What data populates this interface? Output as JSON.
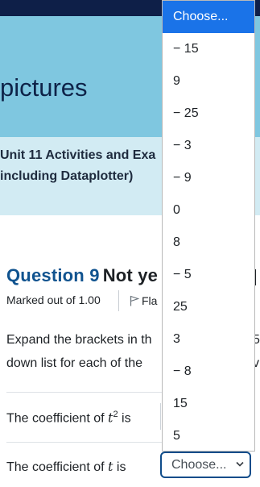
{
  "header": {
    "title_partial": "pictures",
    "subtitle_line1": "Unit 11 Activities and Exa",
    "subtitle_line2": "including Dataplotter)"
  },
  "question": {
    "number_label": "Question 9",
    "status_partial": "Not ye",
    "marked_out_of": "Marked out of 1.00",
    "flag_partial": "Fla",
    "instruction_line1": "Expand the brackets in th",
    "instruction_line2": "down list for each of the",
    "instruction_right1": "5",
    "instruction_right2": "v"
  },
  "rows": [
    {
      "label_prefix": "The coefficient of ",
      "var": "t",
      "sup": "2",
      "label_suffix": " is"
    },
    {
      "label_prefix": "The coefficient of ",
      "var": "t",
      "sup": "",
      "label_suffix": " is"
    }
  ],
  "select": {
    "current_value": "Choose...",
    "chevron_icon": "chevron-down-icon"
  },
  "dropdown": {
    "highlight_color": "#1a73e8",
    "options": [
      "Choose...",
      "− 15",
      "9",
      "− 25",
      "− 3",
      "− 9",
      "0",
      "8",
      "− 5",
      "25",
      "3",
      "− 8",
      "15",
      "5"
    ]
  }
}
